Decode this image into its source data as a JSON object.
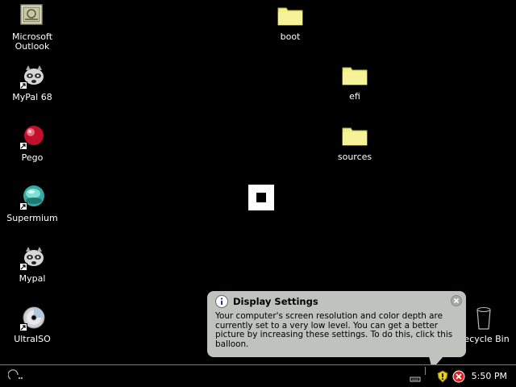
{
  "desktop": {
    "icons": [
      {
        "label": "Microsoft\nOutlook",
        "icon": "outlook-icon"
      },
      {
        "label": "MyPal 68",
        "icon": "mypal-icon",
        "shortcut": true
      },
      {
        "label": "Pego",
        "icon": "pego-icon",
        "shortcut": true
      },
      {
        "label": "Supermium",
        "icon": "supermium-icon",
        "shortcut": true
      },
      {
        "label": "Mypal",
        "icon": "mypal-icon",
        "shortcut": true
      },
      {
        "label": "UltraISO",
        "icon": "cd-icon",
        "shortcut": true
      },
      {
        "label": "boot",
        "icon": "folder-icon"
      },
      {
        "label": "efi",
        "icon": "folder-icon"
      },
      {
        "label": "sources",
        "icon": "folder-icon"
      },
      {
        "label": "Recycle Bin",
        "icon": "recycle-bin-icon"
      }
    ]
  },
  "balloon": {
    "title": "Display Settings",
    "body": "Your computer's screen resolution and color depth are currently set to a very low level. You can get a better picture by increasing these settings. To do this, click this balloon."
  },
  "taskbar": {
    "clock": "5:50 PM"
  },
  "colors": {
    "balloon_bg": "#bfc2bd",
    "folder": "#f3f086",
    "desktop_bg": "#000000"
  }
}
